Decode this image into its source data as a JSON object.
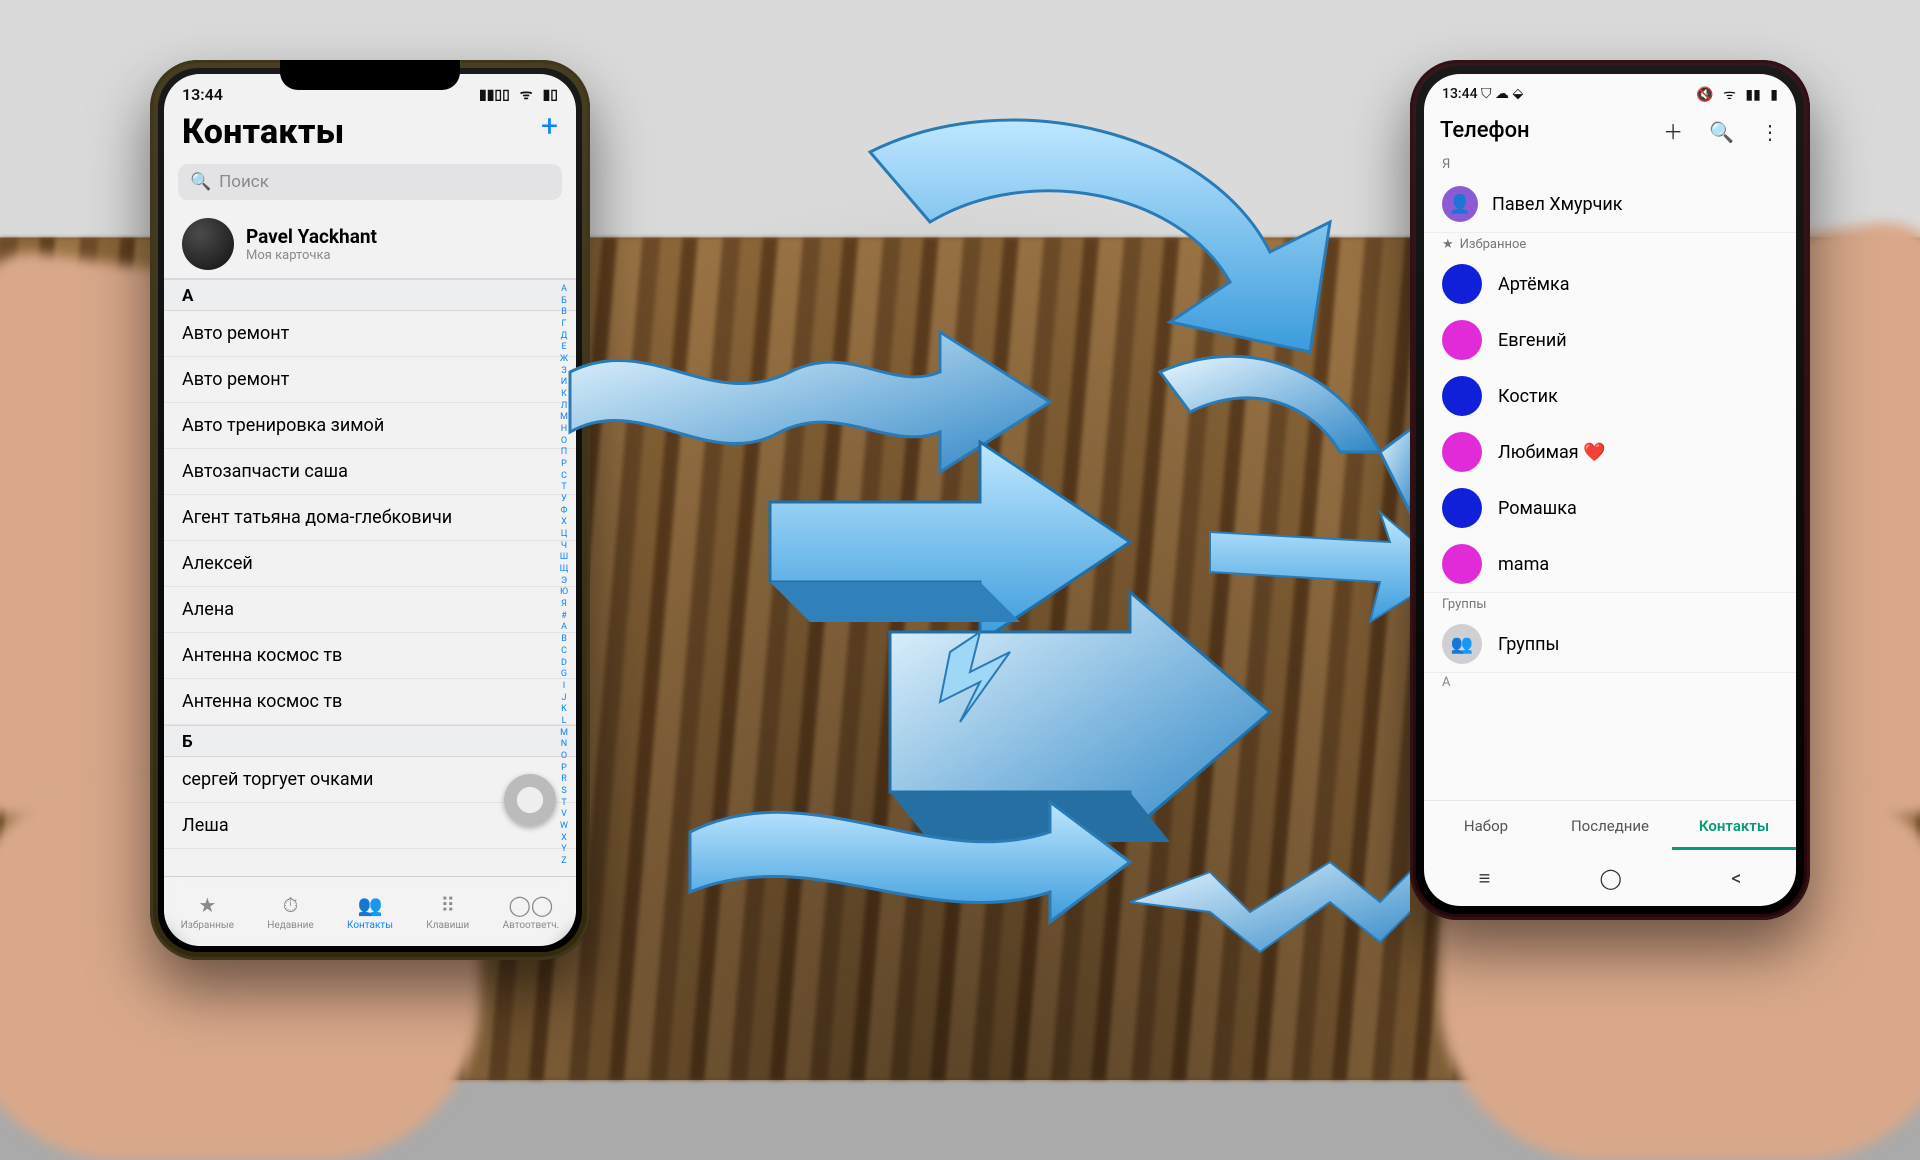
{
  "iphone": {
    "status_time": "13:44",
    "title": "Контакты",
    "search_placeholder": "Поиск",
    "me_name": "Pavel Yackhant",
    "me_sub": "Моя карточка",
    "sections": [
      {
        "letter": "А",
        "rows": [
          "Авто ремонт",
          "Авто ремонт",
          "Авто тренировка зимой",
          "Автозапчасти саша",
          "Агент татьяна дома-глебковичи",
          "Алексей",
          "Алена",
          "Антенна космос тв",
          "Антенна космос тв"
        ]
      },
      {
        "letter": "Б",
        "rows": [
          "сергей торгует очками",
          "Леша"
        ]
      }
    ],
    "tabs": [
      "Избранные",
      "Недавние",
      "Контакты",
      "Клавиши",
      "Автоответч."
    ],
    "active_tab_index": 2,
    "index_letters": [
      "А",
      "Б",
      "В",
      "Г",
      "Д",
      "Е",
      "Ж",
      "З",
      "И",
      "К",
      "Л",
      "М",
      "Н",
      "О",
      "П",
      "Р",
      "С",
      "Т",
      "У",
      "Ф",
      "Х",
      "Ц",
      "Ч",
      "Ш",
      "Щ",
      "Э",
      "Ю",
      "Я",
      "#",
      "A",
      "B",
      "C",
      "D",
      "G",
      "I",
      "J",
      "K",
      "L",
      "M",
      "N",
      "O",
      "P",
      "R",
      "S",
      "T",
      "V",
      "W",
      "X",
      "Y",
      "Z"
    ]
  },
  "samsung": {
    "status_time": "13:44",
    "title": "Телефон",
    "me_section_label": "Я",
    "me_name": "Павел Хмурчик",
    "fav_label": "Избранное",
    "favorites": [
      {
        "name": "Артёмка",
        "color": "#1020d8"
      },
      {
        "name": "Евгений",
        "color": "#e22bd8"
      },
      {
        "name": "Костик",
        "color": "#1020d8"
      },
      {
        "name": "Любимая ❤️",
        "color": "#e22bd8"
      },
      {
        "name": "Ромашка",
        "color": "#1020d8"
      },
      {
        "name": "mama",
        "color": "#e22bd8"
      }
    ],
    "groups_label": "Группы",
    "groups_row": "Группы",
    "letter_A": "A",
    "tabs": [
      "Набор",
      "Последние",
      "Контакты"
    ],
    "active_tab_index": 2
  }
}
